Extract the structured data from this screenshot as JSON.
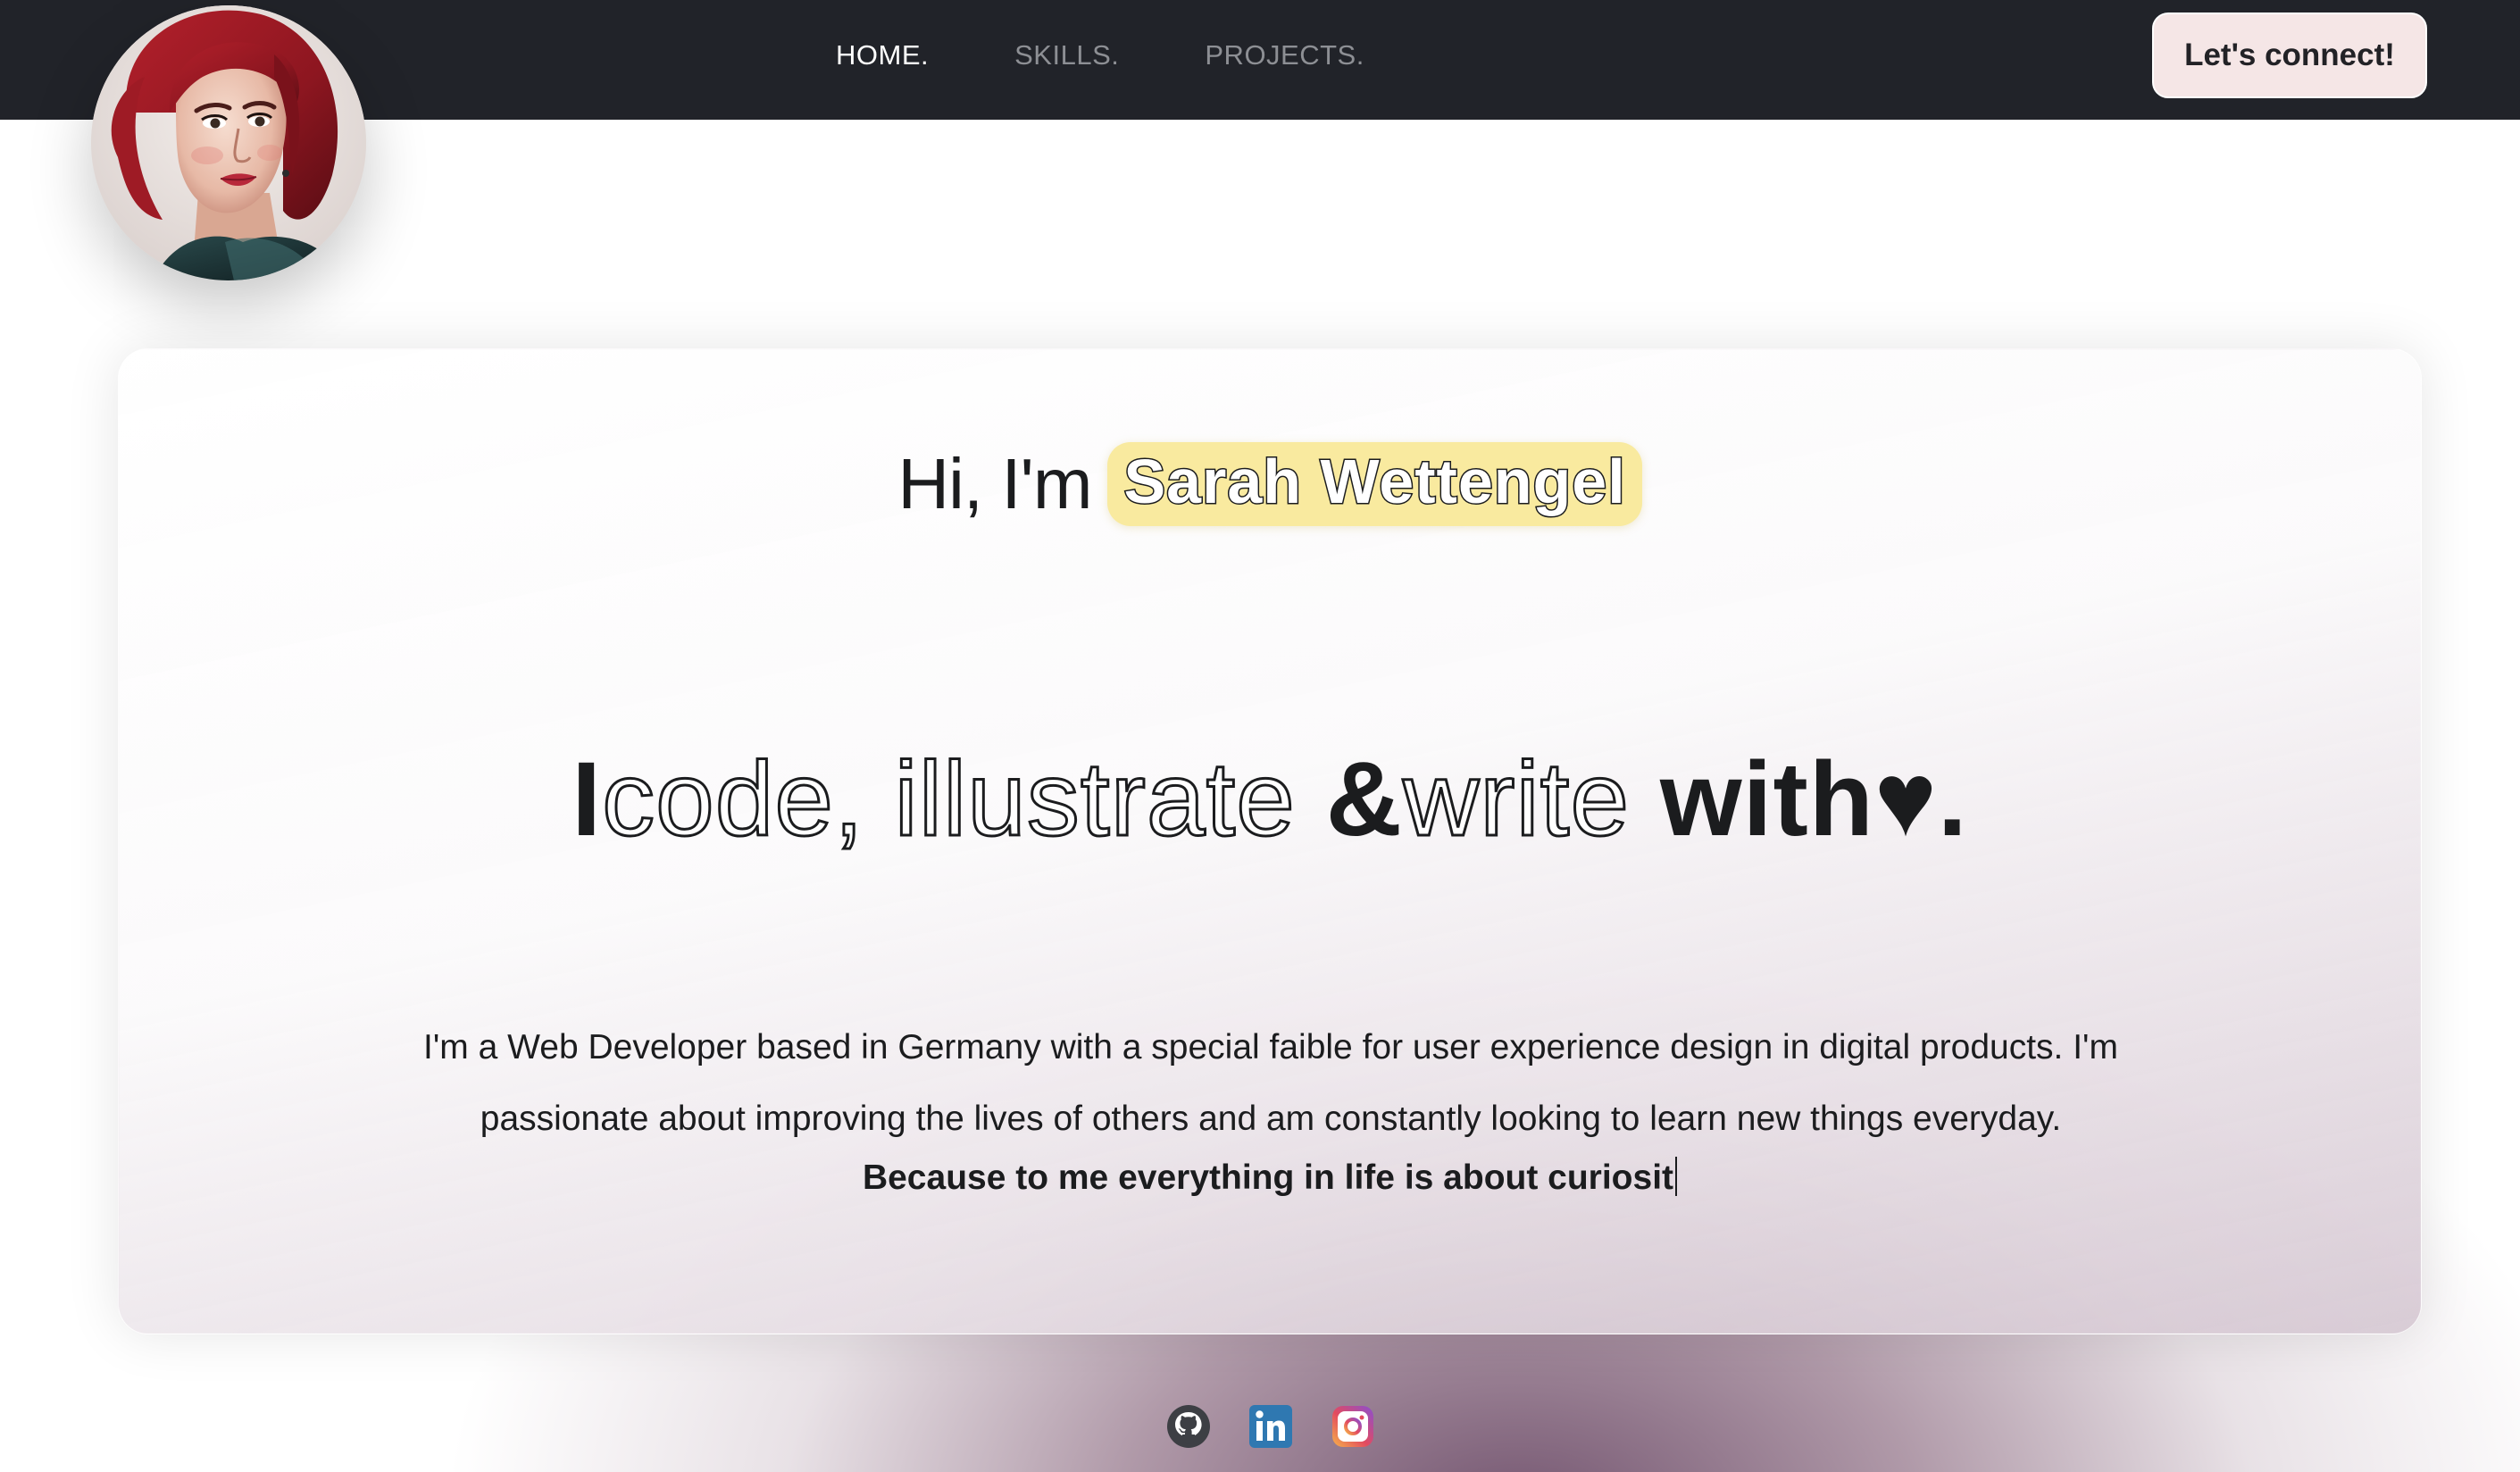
{
  "nav": {
    "links": [
      {
        "label": "HOME."
      },
      {
        "label": "SKILLS."
      },
      {
        "label": "PROJECTS."
      }
    ],
    "cta_label": "Let's connect!"
  },
  "hero": {
    "greeting": "Hi, I'm",
    "name": "Sarah Wettengel",
    "headline": {
      "part1": "I",
      "part2": "code,",
      "part3": "illustrate",
      "part4": "&",
      "part5": "write",
      "part6": "with",
      "heart": "♥",
      "period": "."
    },
    "bio": "I'm a Web Developer based in Germany with a special faible for user experience design in digital products. I'm passionate about improving the lives of others and am constantly looking to learn new things everyday.",
    "tagline": "Because to me everything in life is about curiosit"
  },
  "socials": [
    {
      "icon": "github-icon"
    },
    {
      "icon": "linkedin-icon"
    },
    {
      "icon": "instagram-icon"
    }
  ],
  "colors": {
    "navbar_bg": "#212329",
    "nav_inactive": "#8d8f94",
    "cta_bg": "#f5e6e6",
    "name_highlight": "#f9ea9f",
    "text": "#1b1c1e",
    "linkedin": "#2f78b1"
  }
}
